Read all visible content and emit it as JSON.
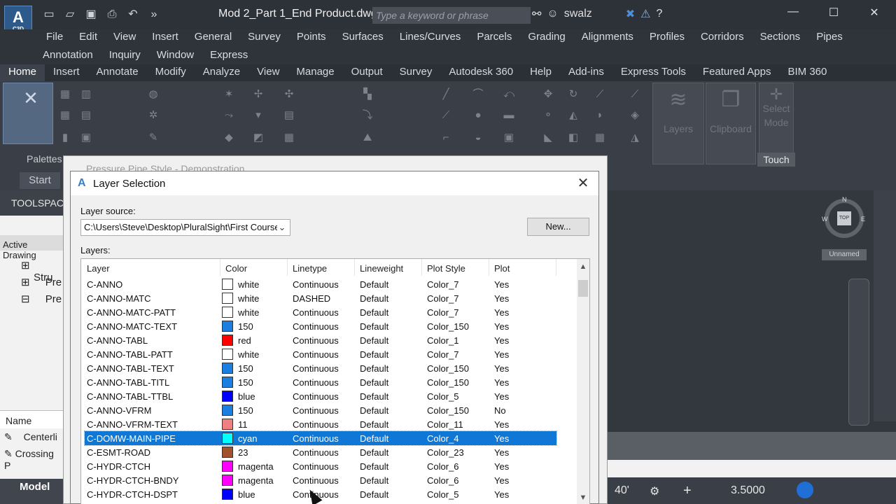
{
  "app": {
    "logo_letter": "A",
    "logo_sub": "C3D",
    "doc_title": "Mod 2_Part 1_End Product.dwg",
    "search_placeholder": "Type a keyword or phrase",
    "username": "swalz"
  },
  "menubar": {
    "row1": [
      "File",
      "Edit",
      "View",
      "Insert",
      "General",
      "Survey",
      "Points",
      "Surfaces",
      "Lines/Curves",
      "Parcels",
      "Grading",
      "Alignments",
      "Profiles",
      "Corridors",
      "Sections",
      "Pipes"
    ],
    "row2": [
      "Annotation",
      "Inquiry",
      "Window",
      "Express"
    ]
  },
  "ribbon_tabs": [
    "Home",
    "Insert",
    "Annotate",
    "Modify",
    "Analyze",
    "View",
    "Manage",
    "Output",
    "Survey",
    "Autodesk 360",
    "Help",
    "Add-ins",
    "Express Tools",
    "Featured Apps",
    "BIM 360"
  ],
  "ribbon": {
    "palettes_label": "Palettes",
    "layers_label": "Layers",
    "clipboard_label": "Clipboard",
    "select_mode_label": "Select Mode",
    "touch_label": "Touch"
  },
  "background": {
    "start_tab": "Start",
    "toolspace_label": "TOOLSPACE",
    "active_drawing": "Active Drawing",
    "tree_items": [
      "Stru",
      "Pre",
      "Pre"
    ],
    "name_header": "Name",
    "list_items": [
      "Centerli",
      "Crossing P"
    ],
    "model_tab": "Model",
    "viewcube_top": "TOP",
    "compass_n": "N",
    "compass_s": "S",
    "compass_e": "E",
    "compass_w": "W",
    "ucs_label": "Unnamed",
    "scale_value": "40'",
    "status_value": "3.5000"
  },
  "parent_dialog": {
    "title": "Pressure Pipe Style - Demonstration"
  },
  "dialog": {
    "title": "Layer Selection",
    "layer_source_label": "Layer source:",
    "layer_source_value": "C:\\Users\\Steve\\Desktop\\PluralSight\\First Course",
    "new_button": "New...",
    "layers_label": "Layers:",
    "columns": [
      "Layer",
      "Color",
      "Linetype",
      "Lineweight",
      "Plot Style",
      "Plot"
    ],
    "rows": [
      {
        "layer": "C-ANNO",
        "color": "white",
        "swatch": "#ffffff",
        "linetype": "Continuous",
        "lineweight": "Default",
        "plotstyle": "Color_7",
        "plot": "Yes"
      },
      {
        "layer": "C-ANNO-MATC",
        "color": "white",
        "swatch": "#ffffff",
        "linetype": "DASHED",
        "lineweight": "Default",
        "plotstyle": "Color_7",
        "plot": "Yes"
      },
      {
        "layer": "C-ANNO-MATC-PATT",
        "color": "white",
        "swatch": "#ffffff",
        "linetype": "Continuous",
        "lineweight": "Default",
        "plotstyle": "Color_7",
        "plot": "Yes"
      },
      {
        "layer": "C-ANNO-MATC-TEXT",
        "color": "150",
        "swatch": "#1a7fe0",
        "linetype": "Continuous",
        "lineweight": "Default",
        "plotstyle": "Color_150",
        "plot": "Yes"
      },
      {
        "layer": "C-ANNO-TABL",
        "color": "red",
        "swatch": "#ff0000",
        "linetype": "Continuous",
        "lineweight": "Default",
        "plotstyle": "Color_1",
        "plot": "Yes"
      },
      {
        "layer": "C-ANNO-TABL-PATT",
        "color": "white",
        "swatch": "#ffffff",
        "linetype": "Continuous",
        "lineweight": "Default",
        "plotstyle": "Color_7",
        "plot": "Yes"
      },
      {
        "layer": "C-ANNO-TABL-TEXT",
        "color": "150",
        "swatch": "#1a7fe0",
        "linetype": "Continuous",
        "lineweight": "Default",
        "plotstyle": "Color_150",
        "plot": "Yes"
      },
      {
        "layer": "C-ANNO-TABL-TITL",
        "color": "150",
        "swatch": "#1a7fe0",
        "linetype": "Continuous",
        "lineweight": "Default",
        "plotstyle": "Color_150",
        "plot": "Yes"
      },
      {
        "layer": "C-ANNO-TABL-TTBL",
        "color": "blue",
        "swatch": "#0000ff",
        "linetype": "Continuous",
        "lineweight": "Default",
        "plotstyle": "Color_5",
        "plot": "Yes"
      },
      {
        "layer": "C-ANNO-VFRM",
        "color": "150",
        "swatch": "#1a7fe0",
        "linetype": "Continuous",
        "lineweight": "Default",
        "plotstyle": "Color_150",
        "plot": "No"
      },
      {
        "layer": "C-ANNO-VFRM-TEXT",
        "color": "11",
        "swatch": "#f08080",
        "linetype": "Continuous",
        "lineweight": "Default",
        "plotstyle": "Color_11",
        "plot": "Yes"
      },
      {
        "layer": "C-DOMW-MAIN-PIPE",
        "color": "cyan",
        "swatch": "#00ffff",
        "linetype": "Continuous",
        "lineweight": "Default",
        "plotstyle": "Color_4",
        "plot": "Yes",
        "selected": true
      },
      {
        "layer": "C-ESMT-ROAD",
        "color": "23",
        "swatch": "#a0522d",
        "linetype": "Continuous",
        "lineweight": "Default",
        "plotstyle": "Color_23",
        "plot": "Yes"
      },
      {
        "layer": "C-HYDR-CTCH",
        "color": "magenta",
        "swatch": "#ff00ff",
        "linetype": "Continuous",
        "lineweight": "Default",
        "plotstyle": "Color_6",
        "plot": "Yes"
      },
      {
        "layer": "C-HYDR-CTCH-BNDY",
        "color": "magenta",
        "swatch": "#ff00ff",
        "linetype": "Continuous",
        "lineweight": "Default",
        "plotstyle": "Color_6",
        "plot": "Yes"
      },
      {
        "layer": "C-HYDR-CTCH-DSPT",
        "color": "blue",
        "swatch": "#0000ff",
        "linetype": "Continuous",
        "lineweight": "Default",
        "plotstyle": "Color_5",
        "plot": "Yes"
      }
    ]
  },
  "colors": {
    "selection": "#0f78d7",
    "dialog_bg": "#f0f0f0",
    "app_dark": "#2b2f36"
  }
}
